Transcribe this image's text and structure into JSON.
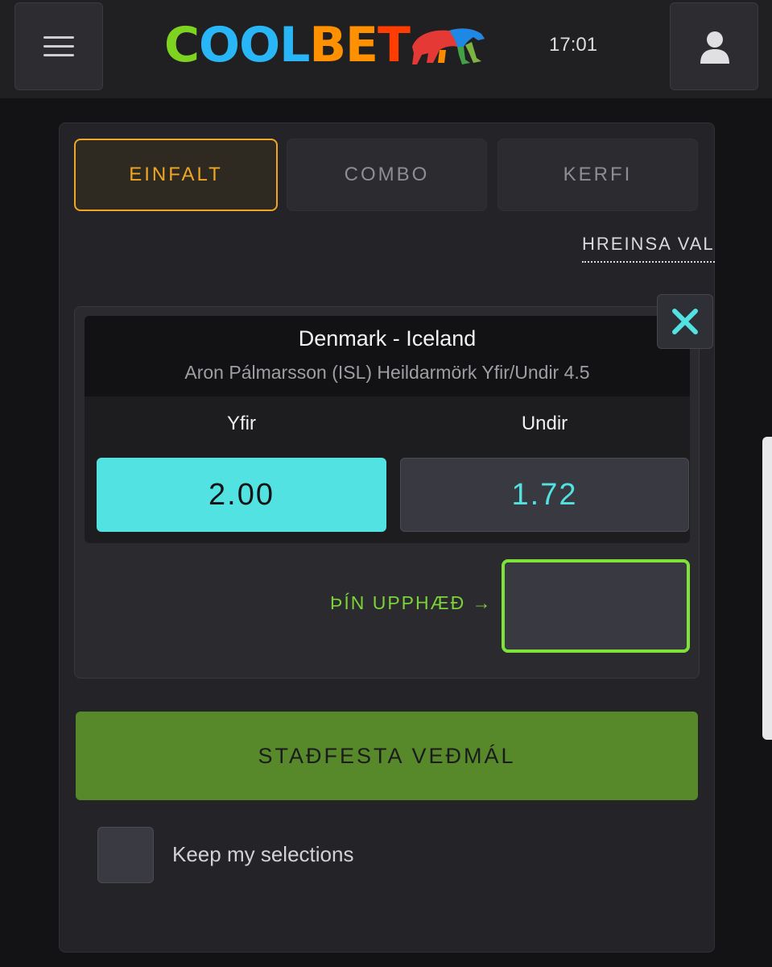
{
  "header": {
    "logo_text": "COOLBET",
    "logo_letters": [
      {
        "char": "C",
        "color": "#7ed321"
      },
      {
        "char": "O",
        "color": "#29b6f6"
      },
      {
        "char": "O",
        "color": "#29b6f6"
      },
      {
        "char": "L",
        "color": "#29b6f6"
      },
      {
        "char": "B",
        "color": "#ff9100"
      },
      {
        "char": "E",
        "color": "#ff9100"
      },
      {
        "char": "T",
        "color": "#ff3d00"
      }
    ],
    "time": "17:01",
    "menu_icon": "hamburger-icon",
    "user_icon": "user-icon"
  },
  "tabs": [
    {
      "label": "EINFALT",
      "active": true
    },
    {
      "label": "COMBO",
      "active": false
    },
    {
      "label": "KERFI",
      "active": false
    }
  ],
  "clear_label": "HREINSA VAL",
  "bet": {
    "match": "Denmark - Iceland",
    "market": "Aron Pálmarsson (ISL) Heildarmörk Yfir/Undir 4.5",
    "outcomes": [
      {
        "label": "Yfir",
        "odds": "2.00",
        "selected": true
      },
      {
        "label": "Undir",
        "odds": "1.72",
        "selected": false
      }
    ],
    "stake_label": "ÞÍN UPPHÆÐ →",
    "stake_value": "",
    "close_icon": "close-icon"
  },
  "confirm_label": "STAÐFESTA VEÐMÁL",
  "keep_selections_label": "Keep my selections",
  "colors": {
    "accent_orange": "#f0a623",
    "accent_cyan": "#52e2e2",
    "accent_green": "#7ee23a",
    "confirm_green": "#57892a"
  }
}
